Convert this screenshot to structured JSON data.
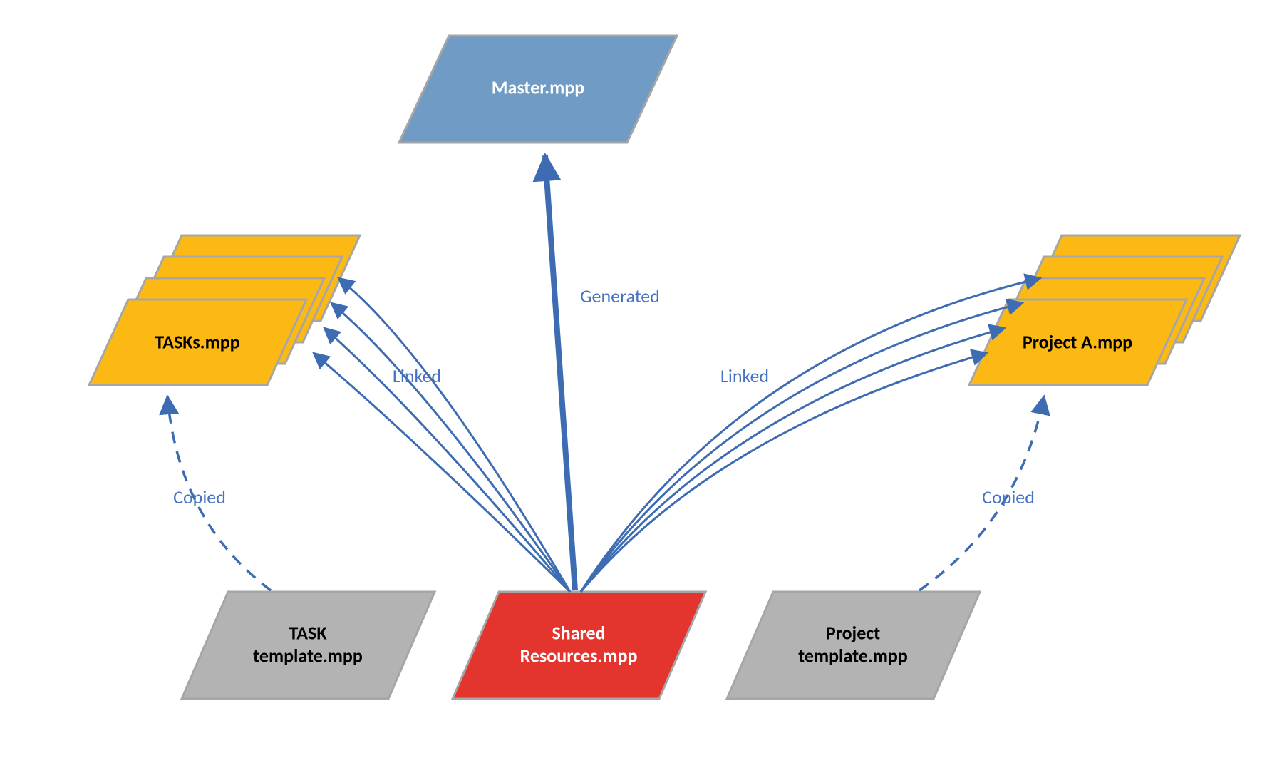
{
  "colors": {
    "blue_fill": "#6f9bc4",
    "red_fill": "#e4342e",
    "gold_fill": "#fdb913",
    "gray_fill": "#b3b3b3",
    "node_border": "#a6a6a6",
    "arrow_blue": "#3d6cb3",
    "label_blue": "#4472c4",
    "white_text": "#ffffff",
    "black_text": "#000000"
  },
  "nodes": {
    "master": {
      "label": "Master.mpp",
      "text_color": "white"
    },
    "tasks": {
      "label": "TASKs.mpp",
      "text_color": "black"
    },
    "projectA": {
      "label": "Project A.mpp",
      "text_color": "black"
    },
    "task_template": {
      "label1": "TASK",
      "label2": "template.mpp",
      "text_color": "black"
    },
    "shared": {
      "label1": "Shared",
      "label2": "Resources.mpp",
      "text_color": "white"
    },
    "proj_template": {
      "label1": "Project",
      "label2": "template.mpp",
      "text_color": "black"
    }
  },
  "edges": {
    "generated": {
      "label": "Generated"
    },
    "linked_l": {
      "label": "Linked"
    },
    "linked_r": {
      "label": "Linked"
    },
    "copied_l": {
      "label": "Copied"
    },
    "copied_r": {
      "label": "Copied"
    }
  }
}
